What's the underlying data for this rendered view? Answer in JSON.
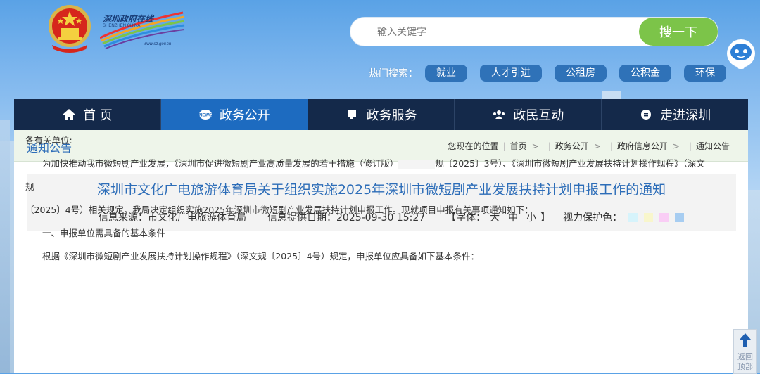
{
  "header": {
    "brand_cn": "深圳政府在线",
    "brand_en": "SHENZHEN CHINA",
    "brand_url": "www.sz.gov.cn"
  },
  "search": {
    "placeholder": "输入关键字",
    "button": "搜一下"
  },
  "hot_search": {
    "label": "热门搜索：",
    "tags": [
      "就业",
      "人才引进",
      "公租房",
      "公积金",
      "环保"
    ]
  },
  "nav": {
    "items": [
      {
        "label": "首 页",
        "icon": "home-icon"
      },
      {
        "label": "政务公开",
        "icon": "news-icon"
      },
      {
        "label": "政务服务",
        "icon": "monitor-icon"
      },
      {
        "label": "政民互动",
        "icon": "people-icon"
      },
      {
        "label": "走进深圳",
        "icon": "chat-icon"
      }
    ],
    "active_index": 1
  },
  "breadcrumb": {
    "section_title": "通知公告",
    "prefix": "您现在的位置",
    "items": [
      "首页",
      "政务公开",
      "政府信息公开",
      "通知公告"
    ]
  },
  "article": {
    "title": "深圳市文化广电旅游体育局关于组织实施2025年深圳市微短剧产业发展扶持计划申报工作的通知",
    "source": "信息来源：市文化广电旅游体育局",
    "date": "信息提供日期：2025-09-30 15:27",
    "font_open": "【字体：",
    "font_sizes": [
      "大",
      "中",
      "小"
    ],
    "font_close": "】",
    "eye_protect_label": "视力保护色：",
    "eye_colors": [
      "#d6f3fb",
      "#f8f6cc",
      "#f9cdf5",
      "#a7cdf1"
    ],
    "paragraphs": [
      "各有关单位:",
      "为加快推动我市微短剧产业发展，《深圳市促进微短剧产业高质量发展的若干措施（修订版）",
      "规〔2025〕3号）、《深圳市微短剧产业发展扶持计划操作规程》（深文规",
      "〔2025〕4号）相关规定，我局决定组织实施2025年深圳市微短剧产业发展扶持计划申报工作。现就项目申报有关事项通知如下：",
      "一、申报单位需具备的基本条件",
      "根据《深圳市微短剧产业发展扶持计划操作规程》（深文规〔2025〕4号）规定，申报单位应具备如下基本条件："
    ]
  },
  "back_to_top": {
    "label": "返回顶部"
  }
}
